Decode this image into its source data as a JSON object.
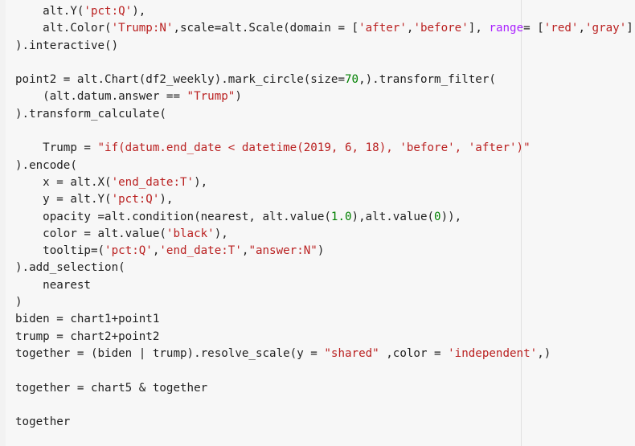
{
  "editor": {
    "language": "python",
    "lines": [
      [
        {
          "t": "    alt.Y("
        },
        {
          "t": "'pct:Q'",
          "c": "str"
        },
        {
          "t": "),"
        }
      ],
      [
        {
          "t": "    alt.Color("
        },
        {
          "t": "'Trump:N'",
          "c": "str"
        },
        {
          "t": ",scale=alt.Scale(domain = ["
        },
        {
          "t": "'after'",
          "c": "str"
        },
        {
          "t": ","
        },
        {
          "t": "'before'",
          "c": "str"
        },
        {
          "t": "], "
        },
        {
          "t": "range",
          "c": "kw"
        },
        {
          "t": "= ["
        },
        {
          "t": "'red'",
          "c": "str"
        },
        {
          "t": ","
        },
        {
          "t": "'gray'",
          "c": "str"
        },
        {
          "t": "]))"
        }
      ],
      [
        {
          "t": ").interactive()"
        }
      ],
      [
        {
          "t": ""
        }
      ],
      [
        {
          "t": "point2 = alt.Chart(df2_weekly).mark_circle(size="
        },
        {
          "t": "70",
          "c": "num"
        },
        {
          "t": ",).transform_filter("
        }
      ],
      [
        {
          "t": "    (alt.datum.answer == "
        },
        {
          "t": "\"Trump\"",
          "c": "str"
        },
        {
          "t": ")"
        }
      ],
      [
        {
          "t": ").transform_calculate("
        }
      ],
      [
        {
          "t": ""
        }
      ],
      [
        {
          "t": "    Trump = "
        },
        {
          "t": "\"if(datum.end_date < datetime(2019, 6, 18), 'before', 'after')\"",
          "c": "str"
        }
      ],
      [
        {
          "t": ").encode("
        }
      ],
      [
        {
          "t": "    x = alt.X("
        },
        {
          "t": "'end_date:T'",
          "c": "str"
        },
        {
          "t": "),"
        }
      ],
      [
        {
          "t": "    y = alt.Y("
        },
        {
          "t": "'pct:Q'",
          "c": "str"
        },
        {
          "t": "),"
        }
      ],
      [
        {
          "t": "    opacity =alt.condition(nearest, alt.value("
        },
        {
          "t": "1.0",
          "c": "num"
        },
        {
          "t": "),alt.value("
        },
        {
          "t": "0",
          "c": "num"
        },
        {
          "t": ")),"
        }
      ],
      [
        {
          "t": "    color = alt.value("
        },
        {
          "t": "'black'",
          "c": "str"
        },
        {
          "t": "),"
        }
      ],
      [
        {
          "t": "    tooltip=("
        },
        {
          "t": "'pct:Q'",
          "c": "str"
        },
        {
          "t": ","
        },
        {
          "t": "'end_date:T'",
          "c": "str"
        },
        {
          "t": ","
        },
        {
          "t": "\"answer:N\"",
          "c": "str"
        },
        {
          "t": ")"
        }
      ],
      [
        {
          "t": ").add_selection("
        }
      ],
      [
        {
          "t": "    nearest"
        }
      ],
      [
        {
          "t": ")"
        }
      ],
      [
        {
          "t": "biden = chart1+point1"
        }
      ],
      [
        {
          "t": "trump = chart2+point2"
        }
      ],
      [
        {
          "t": "together = (biden | trump).resolve_scale(y = "
        },
        {
          "t": "\"shared\"",
          "c": "str"
        },
        {
          "t": " ,color = "
        },
        {
          "t": "'independent'",
          "c": "str"
        },
        {
          "t": ",)"
        }
      ],
      [
        {
          "t": ""
        }
      ],
      [
        {
          "t": "together = chart5 & together"
        }
      ],
      [
        {
          "t": ""
        }
      ],
      [
        {
          "t": "together"
        }
      ]
    ]
  }
}
